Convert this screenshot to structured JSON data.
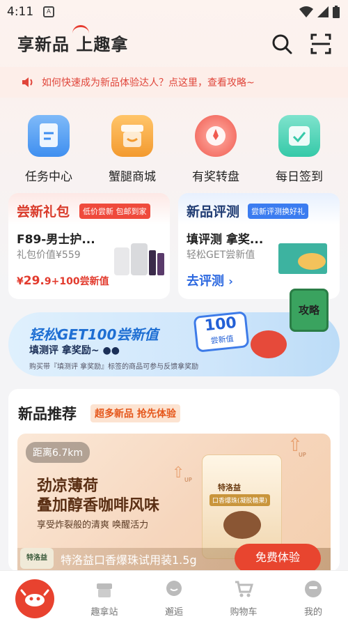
{
  "status_bar": {
    "time": "4:11",
    "app_icon_letter": "A"
  },
  "header": {
    "logo": "享新品 上趣拿"
  },
  "notice": {
    "text": "如何快速成为新品体验达人？点这里，查看攻略~"
  },
  "quick_menu": [
    {
      "label": "任务中心",
      "icon": "clipboard-icon",
      "color": "#3f8ff0"
    },
    {
      "label": "蟹腿商城",
      "icon": "shop-icon",
      "color": "#f39a2f"
    },
    {
      "label": "有奖转盘",
      "icon": "lucky-wheel-icon",
      "color": "#f05a4f"
    },
    {
      "label": "每日签到",
      "icon": "calendar-check-icon",
      "color": "#35c9a8"
    }
  ],
  "card_gift": {
    "title": "尝新礼包",
    "badge": "低价尝新 包邮到家",
    "product": "F89-男士护...",
    "value": "礼包价值¥559",
    "price_symbol": "¥",
    "price_int": "29.",
    "price_dec": "9",
    "price_suffix": "+100尝新值"
  },
  "card_review": {
    "title": "新品评测",
    "badge": "尝新评测换好礼",
    "headline": "填评测 拿奖...",
    "sub": "轻松GET尝新值",
    "link": "去评测"
  },
  "banner": {
    "line1": "轻松GET100尝新值",
    "line2": "填测评 拿奖励~",
    "line3": "购买带『填测评 拿奖励』标签的商品可参与反馈拿奖励",
    "bubble_num": "100",
    "bubble_text": "尝新值",
    "book_text": "攻略"
  },
  "recommend": {
    "title": "新品推荐",
    "tag": "超多新品 抢先体验",
    "distance": "距离6.7km",
    "headline_1": "劲凉薄荷",
    "headline_2": "叠加醇香咖啡风味",
    "subline": "享受炸裂般的清爽 唤醒活力",
    "pack_brand": "特洛益",
    "pack_name": "口香爆珠(凝胶糖果)",
    "brand_logo": "特洛益",
    "product_name": "特洛益口香爆珠试用装1.5g",
    "cta": "免费体验",
    "up_text": "UP"
  },
  "tabbar": [
    {
      "label": "",
      "icon": "crab-home-icon"
    },
    {
      "label": "趣拿站",
      "icon": "store-icon"
    },
    {
      "label": "邂逅",
      "icon": "chat-icon"
    },
    {
      "label": "购物车",
      "icon": "cart-icon"
    },
    {
      "label": "我的",
      "icon": "profile-icon"
    }
  ]
}
